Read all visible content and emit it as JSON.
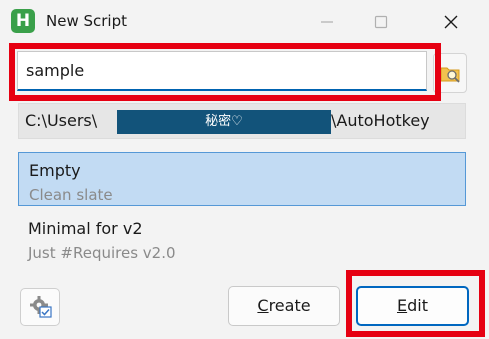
{
  "window": {
    "title": "New Script",
    "app_icon_letter": "H"
  },
  "name_input": {
    "value": "sample"
  },
  "path": {
    "prefix": "C:\\Users\\",
    "redacted": "秘密♡",
    "suffix": "\\AutoHotkey"
  },
  "templates": [
    {
      "name": "Empty",
      "description": "Clean slate",
      "selected": true
    },
    {
      "name": "Minimal for v2",
      "description": "Just #Requires v2.0",
      "selected": false
    }
  ],
  "buttons": {
    "create": {
      "mnemonic": "C",
      "rest": "reate"
    },
    "edit": {
      "mnemonic": "E",
      "rest": "dit"
    }
  },
  "icons": {
    "app": "autohotkey-h-icon",
    "minimize": "minimize-icon",
    "maximize": "maximize-icon",
    "close": "close-icon",
    "browse": "folder-search-icon",
    "settings": "gear-checkbox-icon"
  },
  "colors": {
    "accent": "#0067c0",
    "selection_bg": "#c2dbf3",
    "highlight_frame": "#e60012",
    "app_icon": "#3aa04a",
    "redaction": "#12537a"
  }
}
